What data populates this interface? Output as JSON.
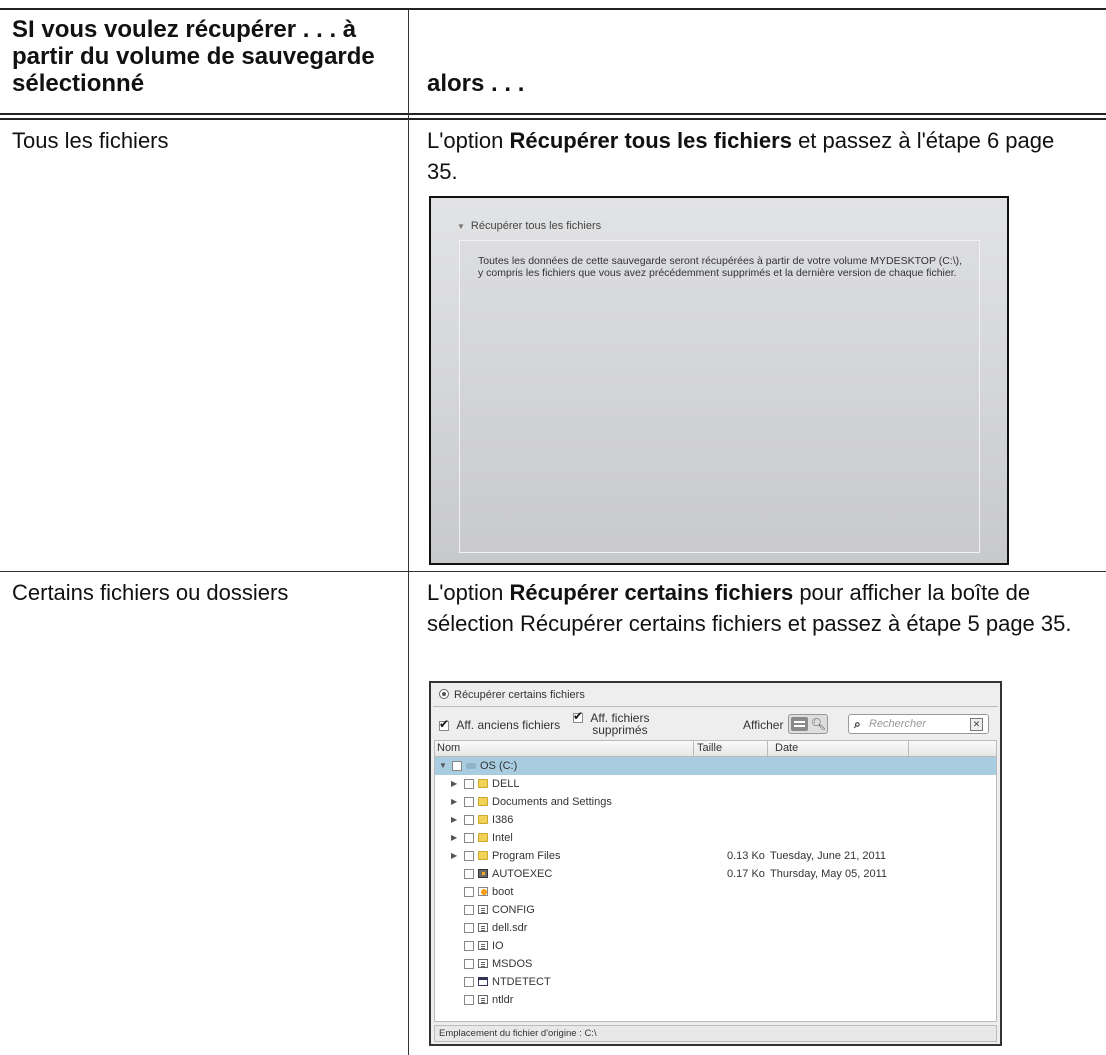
{
  "table": {
    "header_left": "SI vous voulez récupérer . . . à partir du volume de sauvegarde sélectionné",
    "header_right": "alors . . ."
  },
  "rows": [
    {
      "condition": "Tous les fichiers",
      "action_prefix": "L'option ",
      "action_bold": "Récupérer tous les fichiers",
      "action_suffix": " et passez à l'étape 6 page 35."
    },
    {
      "condition": "Certains fichiers ou dossiers",
      "action_prefix": "L'option ",
      "action_bold": "Récupérer certains fichiers",
      "action_suffix": " pour afficher la boîte de sélection Récupérer certains fichiers et passez à étape 5 page 35."
    }
  ],
  "restore_all_dialog": {
    "section_label": "Récupérer tous les fichiers",
    "description": "Toutes les données de cette sauvegarde seront récupérées à partir de votre volume MYDESKTOP (C:\\), y compris les fichiers que vous avez précédemment supprimés et la dernière version de chaque fichier."
  },
  "restore_some_dialog": {
    "section_label": "Récupérer certains fichiers",
    "show_old_files": {
      "label": "Aff. anciens fichiers",
      "checked": true
    },
    "show_deleted_files": {
      "label_line1": "Aff. fichiers",
      "label_line2": "supprimés",
      "checked": true
    },
    "view_label": "Afficher",
    "search_placeholder": "Rechercher",
    "columns": {
      "name": "Nom",
      "size": "Taille",
      "date": "Date"
    },
    "tree": [
      {
        "name": "OS (C:)",
        "icon": "drive-icon",
        "level": 0,
        "expanded": true,
        "selected": true,
        "size": "",
        "date": ""
      },
      {
        "name": "DELL",
        "icon": "folder-icon",
        "level": 1,
        "expanded": false,
        "size": "",
        "date": ""
      },
      {
        "name": "Documents and Settings",
        "icon": "folder-icon",
        "level": 1,
        "expanded": false,
        "size": "",
        "date": ""
      },
      {
        "name": "I386",
        "icon": "folder-icon",
        "level": 1,
        "expanded": false,
        "size": "",
        "date": ""
      },
      {
        "name": "Intel",
        "icon": "folder-icon",
        "level": 1,
        "expanded": false,
        "size": "",
        "date": ""
      },
      {
        "name": "Program Files",
        "icon": "folder-icon",
        "level": 1,
        "expanded": false,
        "size": "0.13 Ko",
        "date": "Tuesday, June 21, 2011"
      },
      {
        "name": "AUTOEXEC",
        "icon": "batch-file-icon",
        "level": 1,
        "size": "0.17 Ko",
        "date": "Thursday, May 05, 2011"
      },
      {
        "name": "boot",
        "icon": "boot-file-icon",
        "level": 1,
        "size": "",
        "date": ""
      },
      {
        "name": "CONFIG",
        "icon": "text-file-icon",
        "level": 1,
        "size": "",
        "date": ""
      },
      {
        "name": "dell.sdr",
        "icon": "text-file-icon",
        "level": 1,
        "size": "",
        "date": ""
      },
      {
        "name": "IO",
        "icon": "text-file-icon",
        "level": 1,
        "size": "",
        "date": ""
      },
      {
        "name": "MSDOS",
        "icon": "text-file-icon",
        "level": 1,
        "size": "",
        "date": ""
      },
      {
        "name": "NTDETECT",
        "icon": "window-file-icon",
        "level": 1,
        "size": "",
        "date": ""
      },
      {
        "name": "ntldr",
        "icon": "text-file-icon",
        "level": 1,
        "size": "",
        "date": ""
      }
    ],
    "status_bar": "Emplacement du fichier d'origine :  C:\\"
  }
}
